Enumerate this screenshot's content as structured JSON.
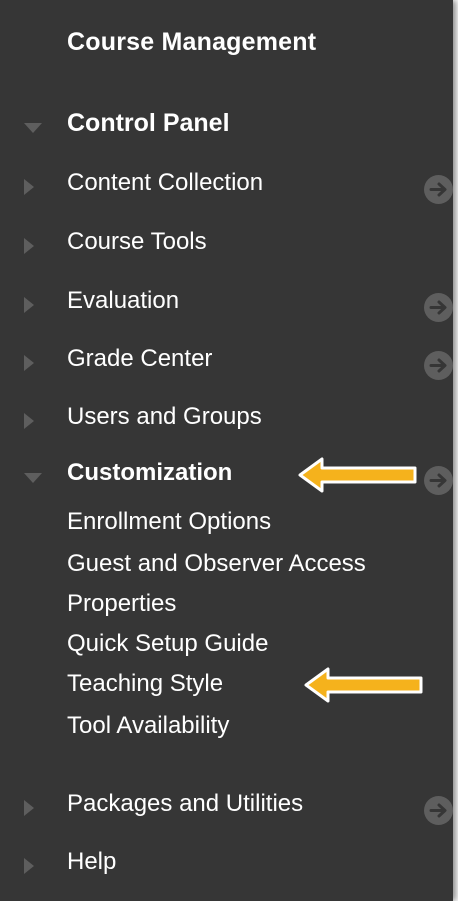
{
  "panel": {
    "title": "Course Management"
  },
  "control_panel": {
    "label": "Control Panel"
  },
  "items": [
    {
      "label": "Content Collection"
    },
    {
      "label": "Course Tools"
    },
    {
      "label": "Evaluation"
    },
    {
      "label": "Grade Center"
    },
    {
      "label": "Users and Groups"
    }
  ],
  "customization": {
    "label": "Customization",
    "subitems": [
      {
        "label": "Enrollment Options"
      },
      {
        "label": "Guest and Observer Access"
      },
      {
        "label": "Properties"
      },
      {
        "label": "Quick Setup Guide"
      },
      {
        "label": "Teaching Style"
      },
      {
        "label": "Tool Availability"
      }
    ]
  },
  "bottom_items": [
    {
      "label": "Packages and Utilities"
    },
    {
      "label": "Help"
    }
  ],
  "colors": {
    "panel_bg": "#363636",
    "text": "#ffffff",
    "icon": "#5e5e5e",
    "callout_arrow": "#f5b21c"
  },
  "icons": {
    "expand": "triangle-right-icon",
    "collapse": "triangle-down-icon",
    "go": "circle-arrow-right-icon",
    "callout": "yellow-arrow-left-icon"
  }
}
